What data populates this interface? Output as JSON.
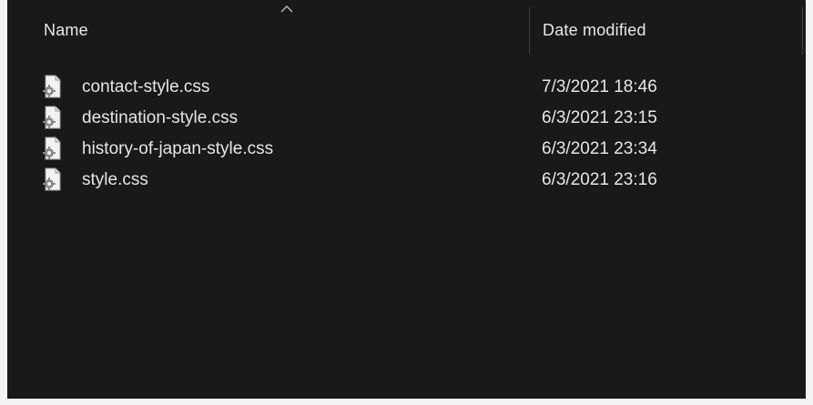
{
  "columns": {
    "name": "Name",
    "date_modified": "Date modified"
  },
  "sort": {
    "icon": "chevron-up-icon"
  },
  "files": [
    {
      "name": "contact-style.css",
      "date": "7/3/2021 18:46",
      "icon": "css-file-icon"
    },
    {
      "name": "destination-style.css",
      "date": "6/3/2021 23:15",
      "icon": "css-file-icon"
    },
    {
      "name": "history-of-japan-style.css",
      "date": "6/3/2021 23:34",
      "icon": "css-file-icon"
    },
    {
      "name": "style.css",
      "date": "6/3/2021 23:16",
      "icon": "css-file-icon"
    }
  ],
  "colors": {
    "background": "#191919",
    "text": "#e6e6e6",
    "frame": "#f3f3f3"
  }
}
